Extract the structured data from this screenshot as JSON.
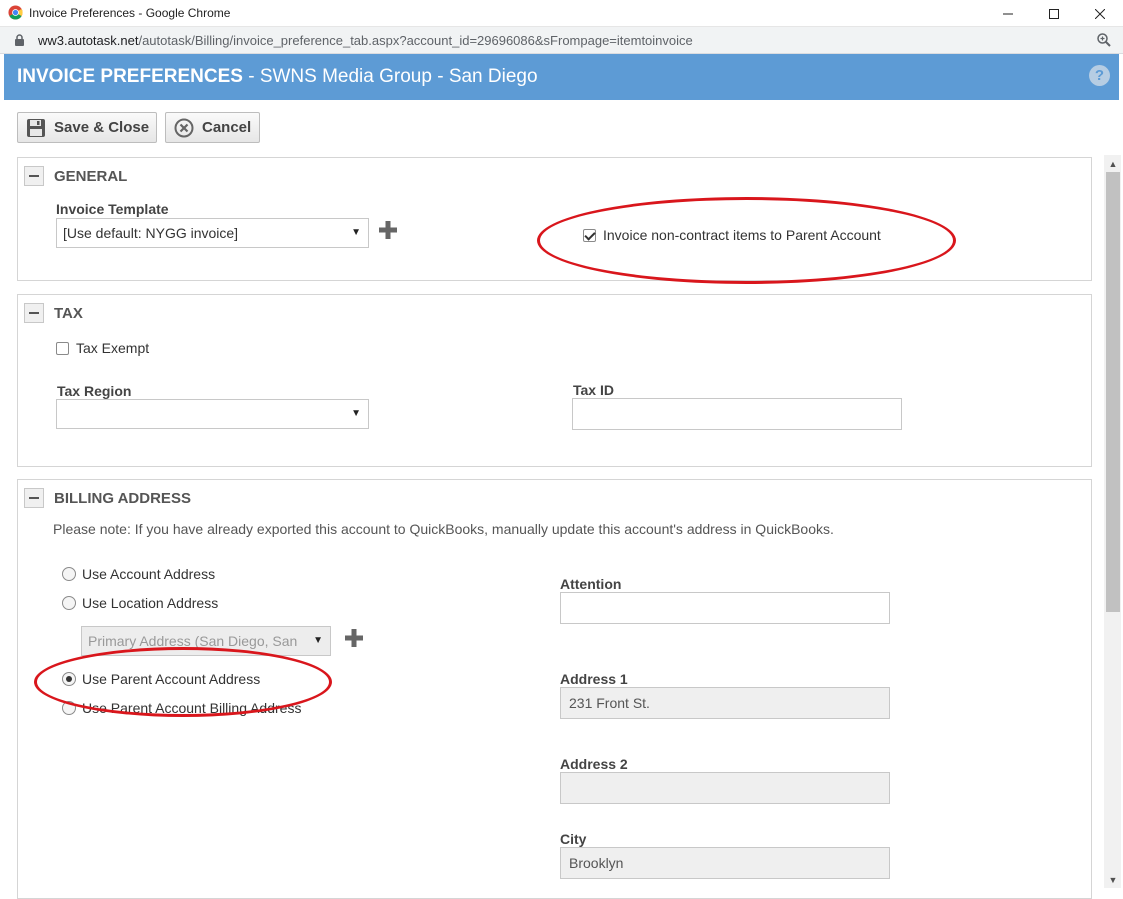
{
  "window": {
    "title": "Invoice Preferences - Google Chrome",
    "url_host": "ww3.autotask.net",
    "url_path": "/autotask/Billing/invoice_preference_tab.aspx?account_id=29696086&sFrompage=itemtoinvoice"
  },
  "header": {
    "title_bold": "INVOICE PREFERENCES",
    "title_rest": " - SWNS Media Group - San Diego",
    "help": "?"
  },
  "toolbar": {
    "save_label": "Save & Close",
    "cancel_label": "Cancel"
  },
  "general": {
    "title": "GENERAL",
    "template_label": "Invoice Template",
    "template_value": "[Use default: NYGG invoice]",
    "parent_invoice_label": "Invoice non-contract items to Parent Account",
    "parent_invoice_checked": true
  },
  "tax": {
    "title": "TAX",
    "exempt_label": "Tax Exempt",
    "exempt_checked": false,
    "region_label": "Tax Region",
    "region_value": "",
    "taxid_label": "Tax ID",
    "taxid_value": ""
  },
  "billing": {
    "title": "BILLING ADDRESS",
    "note": "Please note: If you have already exported this account to QuickBooks, manually update this account's address in QuickBooks.",
    "options": [
      {
        "label": "Use Account Address",
        "selected": false
      },
      {
        "label": "Use Location Address",
        "selected": false
      },
      {
        "label": "Use Parent Account Address",
        "selected": true
      },
      {
        "label": "Use Parent Account Billing Address",
        "selected": false
      }
    ],
    "location_value": "Primary Address (San Diego, San",
    "attention_label": "Attention",
    "attention_value": "",
    "address1_label": "Address 1",
    "address1_value": "231 Front St.",
    "address2_label": "Address 2",
    "address2_value": "",
    "city_label": "City",
    "city_value": "Brooklyn"
  },
  "colors": {
    "header": "#5d9bd5",
    "highlight_circle": "#d9161c"
  }
}
